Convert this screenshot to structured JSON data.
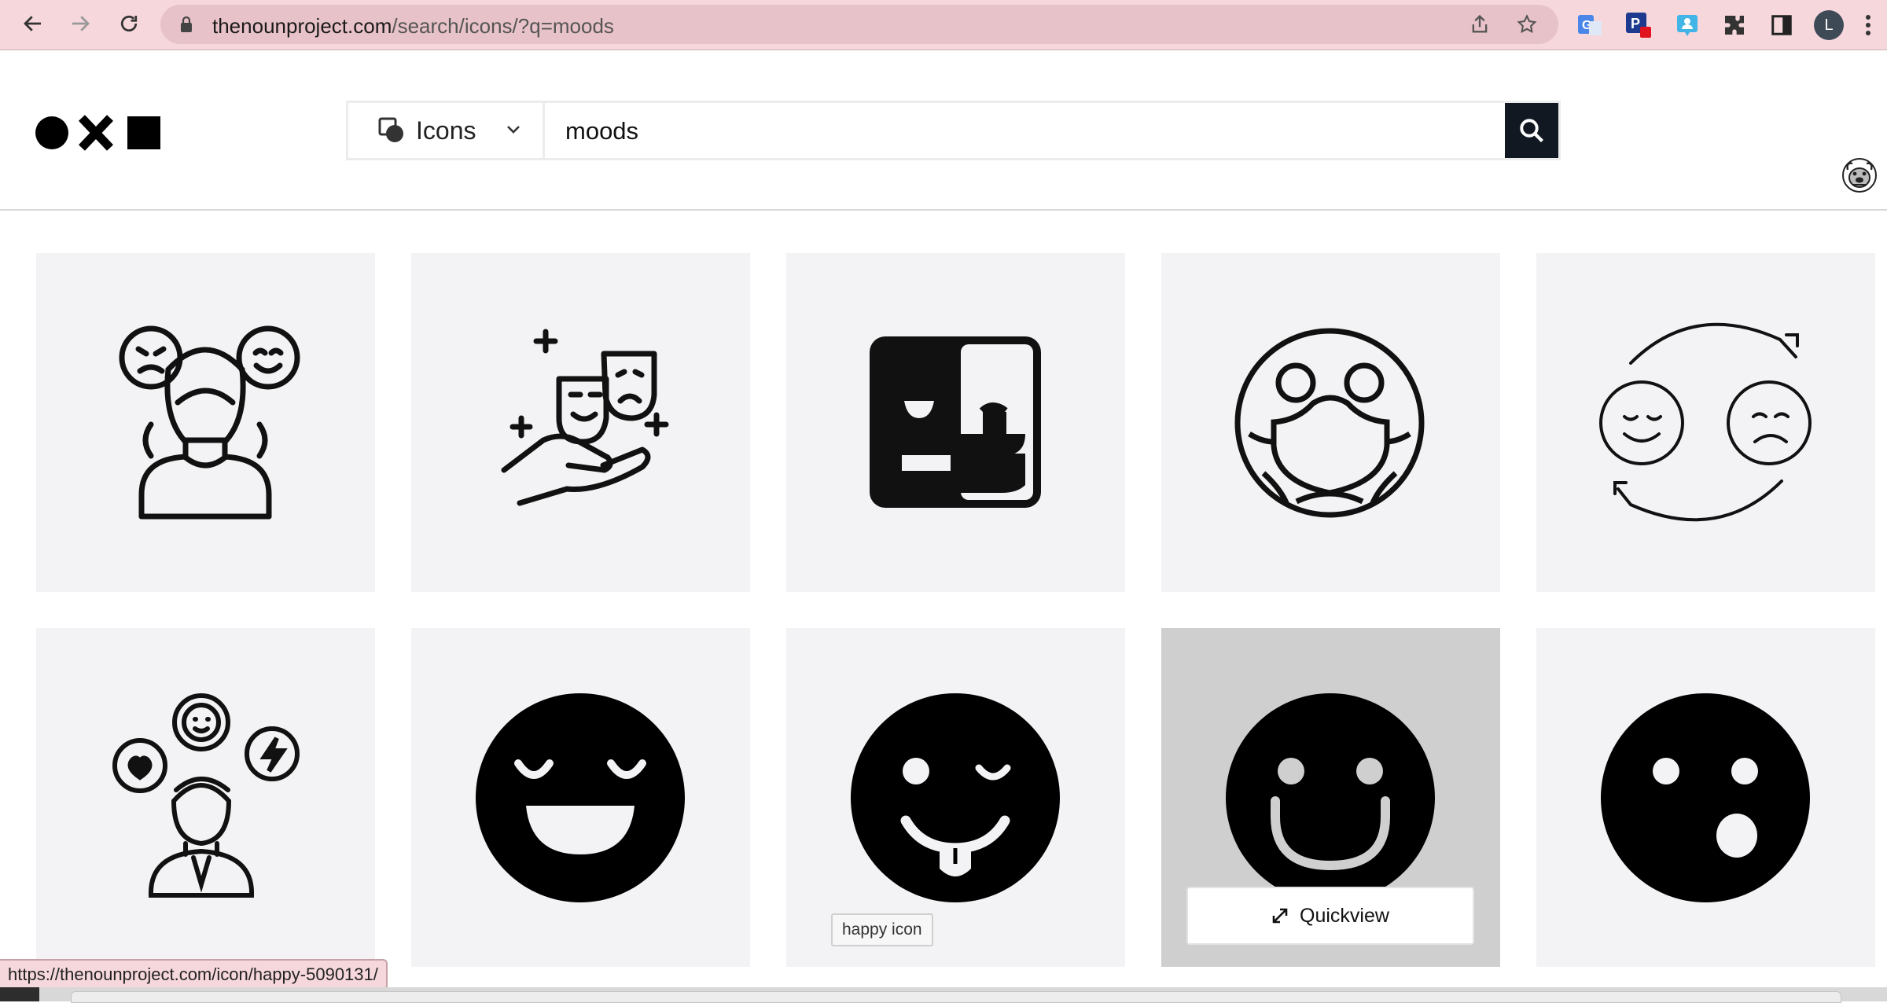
{
  "browser": {
    "url_host": "thenounproject.com",
    "url_path": "/search/icons/?q=moods",
    "profile_initial": "L"
  },
  "search": {
    "type_label": "Icons",
    "query": "moods",
    "placeholder": ""
  },
  "results": [
    {
      "icon": "person-moods-icon"
    },
    {
      "icon": "theater-masks-hand-icon"
    },
    {
      "icon": "split-face-icon"
    },
    {
      "icon": "masked-face-icon"
    },
    {
      "icon": "mood-swing-icon"
    },
    {
      "icon": "emotional-person-icon"
    },
    {
      "icon": "laughing-face-icon"
    },
    {
      "icon": "tongue-wink-face-icon"
    },
    {
      "icon": "happy-face-icon"
    },
    {
      "icon": "surprised-face-icon"
    }
  ],
  "quickview_label": "Quickview",
  "tooltip_text": "happy icon",
  "status_url": "https://thenounproject.com/icon/happy-5090131/",
  "colors": {
    "chrome_bg": "#f6d7dc",
    "search_button": "#111821",
    "tile_bg": "#f3f3f5",
    "tile_hover": "#cfcfcf"
  }
}
